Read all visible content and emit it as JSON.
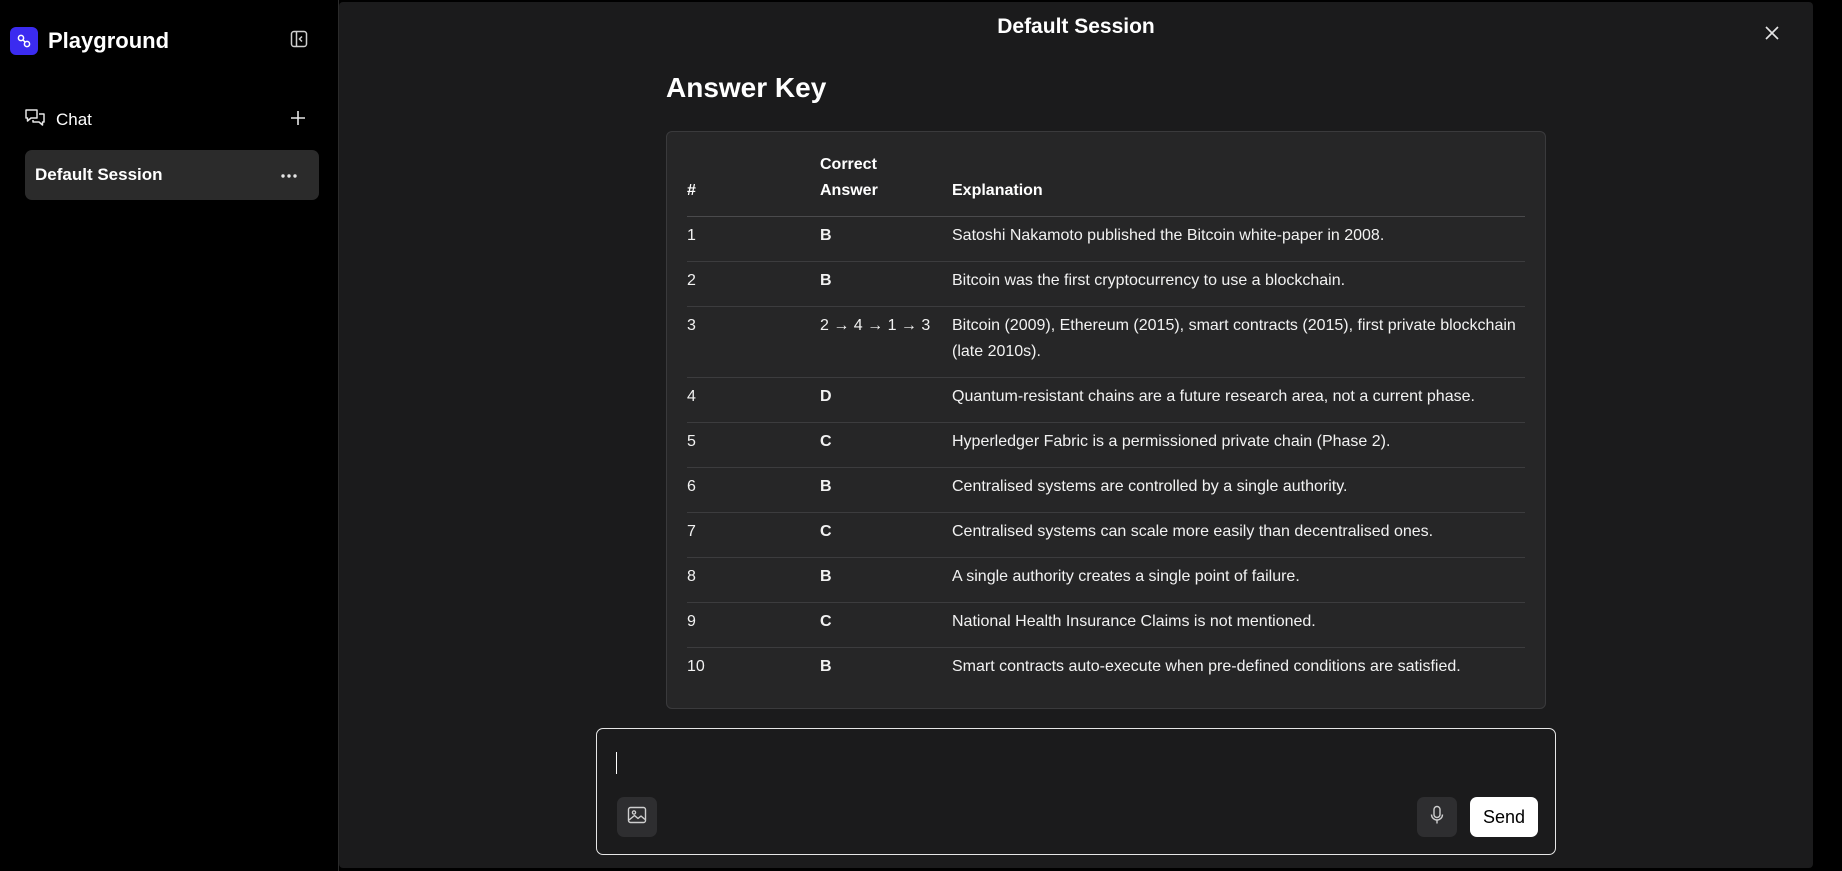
{
  "sidebar": {
    "app_name": "Playground",
    "chat_label": "Chat",
    "sessions": [
      {
        "label": "Default Session"
      }
    ]
  },
  "header": {
    "title": "Default Session"
  },
  "content": {
    "title": "Answer Key",
    "table": {
      "headers": [
        "#",
        "Correct Answer",
        "Explanation"
      ],
      "rows": [
        [
          "1",
          "B",
          "Satoshi Nakamoto published the Bitcoin white-paper in 2008."
        ],
        [
          "2",
          "B",
          "Bitcoin was the first cryptocurrency to use a blockchain."
        ],
        [
          "3",
          "2 → 4 → 1 → 3",
          "Bitcoin (2009), Ethereum (2015), smart contracts (2015), first private blockchain (late 2010s)."
        ],
        [
          "4",
          "D",
          "Quantum-resistant chains are a future research area, not a current phase."
        ],
        [
          "5",
          "C",
          "Hyperledger Fabric is a permissioned private chain (Phase 2)."
        ],
        [
          "6",
          "B",
          "Centralised systems are controlled by a single authority."
        ],
        [
          "7",
          "C",
          "Centralised systems can scale more easily than decentralised ones."
        ],
        [
          "8",
          "B",
          "A single authority creates a single point of failure."
        ],
        [
          "9",
          "C",
          "National Health Insurance Claims is not mentioned."
        ],
        [
          "10",
          "B",
          "Smart contracts auto-execute when pre-defined conditions are satisfied."
        ]
      ]
    }
  },
  "composer": {
    "value": "",
    "placeholder": "",
    "send_label": "Send"
  },
  "icons": {
    "brand": "playground-logo-icon",
    "collapse": "sidebar-collapse-icon",
    "chat": "chat-bubbles-icon",
    "new_chat": "plus-icon",
    "session_more": "ellipsis-icon",
    "close": "close-icon",
    "image": "image-icon",
    "mic": "microphone-icon"
  },
  "colors": {
    "accent": "#3b2bf0",
    "background": "#000000",
    "panel": "#1b1b1c",
    "table_card": "#262627",
    "session_selected": "#2b2b2b"
  }
}
